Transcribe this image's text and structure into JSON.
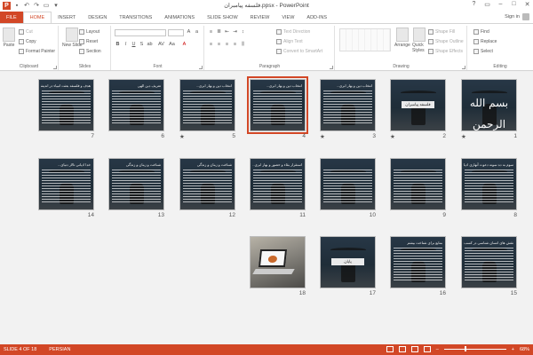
{
  "window": {
    "title": "فلسفه پیامبران.ppsx - PowerPoint",
    "controls": [
      "?",
      "▭",
      "–",
      "□",
      "✕"
    ]
  },
  "tabs": [
    {
      "label": "FILE",
      "kind": "file"
    },
    {
      "label": "HOME",
      "kind": "active"
    },
    {
      "label": "INSERT",
      "kind": ""
    },
    {
      "label": "DESIGN",
      "kind": ""
    },
    {
      "label": "TRANSITIONS",
      "kind": ""
    },
    {
      "label": "ANIMATIONS",
      "kind": ""
    },
    {
      "label": "SLIDE SHOW",
      "kind": ""
    },
    {
      "label": "REVIEW",
      "kind": ""
    },
    {
      "label": "VIEW",
      "kind": ""
    },
    {
      "label": "ADD-INS",
      "kind": ""
    }
  ],
  "signin": "Sign in",
  "ribbon": {
    "clipboard": {
      "paste": "Paste",
      "cut": "Cut",
      "copy": "Copy",
      "format_painter": "Format Painter",
      "label": "Clipboard"
    },
    "slides": {
      "new_slide": "New Slide",
      "layout": "Layout",
      "reset": "Reset",
      "section": "Section",
      "label": "Slides"
    },
    "font": {
      "label": "Font"
    },
    "paragraph": {
      "text_direction": "Text Direction",
      "align_text": "Align Text",
      "convert_smartart": "Convert to SmartArt",
      "label": "Paragraph"
    },
    "drawing": {
      "arrange": "Arrange",
      "quick_styles": "Quick Styles",
      "shape_fill": "Shape Fill",
      "shape_outline": "Shape Outline",
      "shape_effects": "Shape Effects",
      "label": "Drawing"
    },
    "editing": {
      "find": "Find",
      "replace": "Replace",
      "select": "Select",
      "label": "Editing"
    }
  },
  "slides": [
    {
      "num": "1",
      "star": "★",
      "style": "cover",
      "header": "",
      "text": "بسم الله الرحمن الرحیم",
      "selected": false
    },
    {
      "num": "2",
      "star": "★",
      "style": "title",
      "header": "",
      "text": "فلسفه پیامبران",
      "selected": false
    },
    {
      "num": "3",
      "star": "★",
      "style": "text",
      "header": "انتخاب دین و بهار ابری...",
      "text": "",
      "selected": false
    },
    {
      "num": "4",
      "star": "",
      "style": "text",
      "header": "انتخاب دین و بهار ابری...",
      "text": "",
      "selected": true
    },
    {
      "num": "5",
      "star": "★",
      "style": "text",
      "header": "انتخاب دین و بهار ابری...",
      "text": "",
      "selected": false
    },
    {
      "num": "6",
      "star": "",
      "style": "text",
      "header": "تعریف دین الهی",
      "text": "",
      "selected": false
    },
    {
      "num": "7",
      "star": "",
      "style": "text",
      "header": "هدف و فلسفه بعثت انبیاء در اندیشه الهی",
      "text": "",
      "selected": false
    },
    {
      "num": "8",
      "star": "",
      "style": "text",
      "header": "سوم به ده نمونه دعوت آنهاری ادیان الهی",
      "text": "",
      "selected": false
    },
    {
      "num": "9",
      "star": "",
      "style": "text",
      "header": "",
      "text": "",
      "selected": false
    },
    {
      "num": "10",
      "star": "",
      "style": "text",
      "header": "",
      "text": "",
      "selected": false
    },
    {
      "num": "11",
      "star": "",
      "style": "text",
      "header": "استقرار بقاء و حضور و بهار ابری...",
      "text": "",
      "selected": false
    },
    {
      "num": "12",
      "star": "",
      "style": "text",
      "header": "شناخت و زمان و زندگی",
      "text": "",
      "selected": false
    },
    {
      "num": "13",
      "star": "",
      "style": "text",
      "header": "شناخت و زمان و زندگی",
      "text": "",
      "selected": false
    },
    {
      "num": "14",
      "star": "",
      "style": "text",
      "header": "خدا ادیانی تالار دنیای...",
      "text": "",
      "selected": false
    },
    {
      "num": "15",
      "star": "",
      "style": "text",
      "header": "نقش های انسان شناسی در کسب هدف و سعادت ابدی",
      "text": "",
      "selected": false
    },
    {
      "num": "16",
      "star": "",
      "style": "text",
      "header": "منابع برای شناخت بیشتر",
      "text": "",
      "selected": false
    },
    {
      "num": "17",
      "star": "",
      "style": "title",
      "header": "",
      "text": "پایان",
      "selected": false
    },
    {
      "num": "18",
      "star": "",
      "style": "photo",
      "header": "",
      "text": "",
      "selected": false
    }
  ],
  "status": {
    "slide_info": "SLIDE 4 OF 18",
    "language": "PERSIAN",
    "zoom": "68%",
    "zoom_fraction": 0.68
  }
}
